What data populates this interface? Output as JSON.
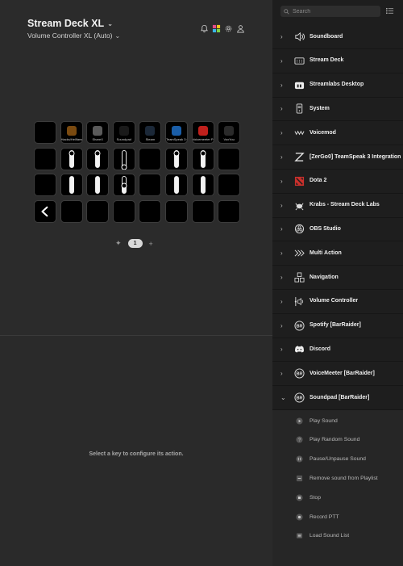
{
  "header": {
    "device_title": "Stream Deck XL",
    "profile": "Volume Controller XL (Auto)"
  },
  "grid": {
    "keys": [
      {
        "type": "empty",
        "label": ""
      },
      {
        "type": "app",
        "label": "Hacks/Hellfans",
        "icon_color": "#7a4a10"
      },
      {
        "type": "app",
        "label": "ShareX",
        "icon_color": "#5a5a5a"
      },
      {
        "type": "app",
        "label": "Soundpad",
        "icon_color": "#1a1a1a"
      },
      {
        "type": "app",
        "label": "Steam",
        "icon_color": "#1b2838"
      },
      {
        "type": "app",
        "label": "TeamSpeak 3 Cl...",
        "icon_color": "#1a5ea8"
      },
      {
        "type": "app",
        "label": "Voicemeeter Po...",
        "icon_color": "#c0201c"
      },
      {
        "type": "app",
        "label": "VoxYou",
        "icon_color": "#2a2a2a"
      },
      {
        "type": "empty",
        "label": ""
      },
      {
        "type": "slider",
        "level": 0.85
      },
      {
        "type": "slider",
        "level": 0.85
      },
      {
        "type": "slider",
        "level": 0.0
      },
      {
        "type": "empty",
        "label": ""
      },
      {
        "type": "slider",
        "level": 0.85
      },
      {
        "type": "slider",
        "level": 0.85
      },
      {
        "type": "empty",
        "label": ""
      },
      {
        "type": "empty",
        "label": ""
      },
      {
        "type": "slider",
        "level": 1.0
      },
      {
        "type": "slider",
        "level": 1.0
      },
      {
        "type": "slider",
        "level": 0.45
      },
      {
        "type": "empty",
        "label": ""
      },
      {
        "type": "slider",
        "level": 1.0
      },
      {
        "type": "slider",
        "level": 1.0
      },
      {
        "type": "empty",
        "label": ""
      },
      {
        "type": "back",
        "label": ""
      },
      {
        "type": "empty",
        "label": ""
      },
      {
        "type": "empty",
        "label": ""
      },
      {
        "type": "empty",
        "label": ""
      },
      {
        "type": "empty",
        "label": ""
      },
      {
        "type": "empty",
        "label": ""
      },
      {
        "type": "empty",
        "label": ""
      },
      {
        "type": "empty",
        "label": ""
      }
    ]
  },
  "pager": {
    "current_page": "1"
  },
  "hint": "Select a key to configure its action.",
  "sidebar": {
    "search_placeholder": "Search",
    "categories": [
      {
        "label": "Soundboard",
        "icon": "speaker-icon",
        "expanded": false
      },
      {
        "label": "Stream Deck",
        "icon": "stream-deck-icon",
        "expanded": false
      },
      {
        "label": "Streamlabs Desktop",
        "icon": "streamlabs-icon",
        "expanded": false
      },
      {
        "label": "System",
        "icon": "system-icon",
        "expanded": false
      },
      {
        "label": "Voicemod",
        "icon": "voicemod-icon",
        "expanded": false
      },
      {
        "label": "[ZerGo0] TeamSpeak 3 Integration",
        "icon": "teamspeak-icon",
        "expanded": false
      },
      {
        "label": "Dota 2",
        "icon": "dota-icon",
        "expanded": false
      },
      {
        "label": "Krabs - Stream Deck Labs",
        "icon": "krabs-icon",
        "expanded": false
      },
      {
        "label": "OBS Studio",
        "icon": "obs-icon",
        "expanded": false
      },
      {
        "label": "Multi Action",
        "icon": "multi-action-icon",
        "expanded": false
      },
      {
        "label": "Navigation",
        "icon": "navigation-icon",
        "expanded": false
      },
      {
        "label": "Volume Controller",
        "icon": "volume-controller-icon",
        "expanded": false
      },
      {
        "label": "Spotify [BarRaider]",
        "icon": "barraider-icon",
        "expanded": false
      },
      {
        "label": "Discord",
        "icon": "discord-icon",
        "expanded": false
      },
      {
        "label": "VoiceMeeter [BarRaider]",
        "icon": "barraider-icon",
        "expanded": false
      },
      {
        "label": "Soundpad [BarRaider]",
        "icon": "barraider-icon",
        "expanded": true
      }
    ],
    "soundpad_actions": [
      {
        "label": "Play Sound",
        "icon": "play-icon"
      },
      {
        "label": "Play Random Sound",
        "icon": "random-icon"
      },
      {
        "label": "Pause/Unpause Sound",
        "icon": "pause-icon"
      },
      {
        "label": "Remove sound from Playlist",
        "icon": "remove-icon"
      },
      {
        "label": "Stop",
        "icon": "stop-icon"
      },
      {
        "label": "Record PTT",
        "icon": "record-icon"
      },
      {
        "label": "Load Sound List",
        "icon": "list-icon"
      }
    ]
  },
  "colors": {
    "left_bg": "#2b2b2b",
    "right_bg": "#1e1e1e",
    "accent_dota": "#d0342c",
    "accent_streamlabs": "#31c3a2"
  }
}
